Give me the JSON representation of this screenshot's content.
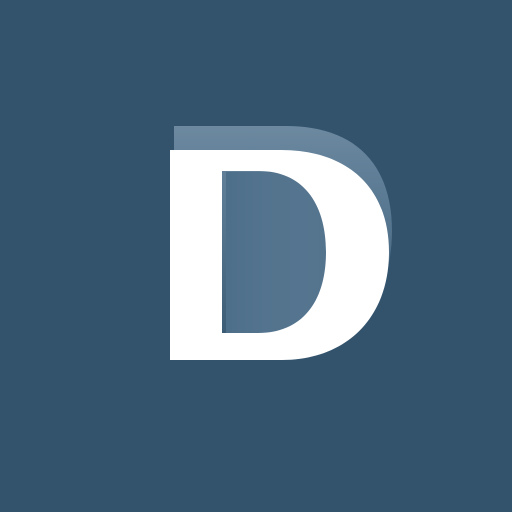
{
  "logo": {
    "letter": "D",
    "background_color": "#33536d",
    "letter_color": "#ffffff",
    "shadow_color": "#6f8ea8"
  }
}
